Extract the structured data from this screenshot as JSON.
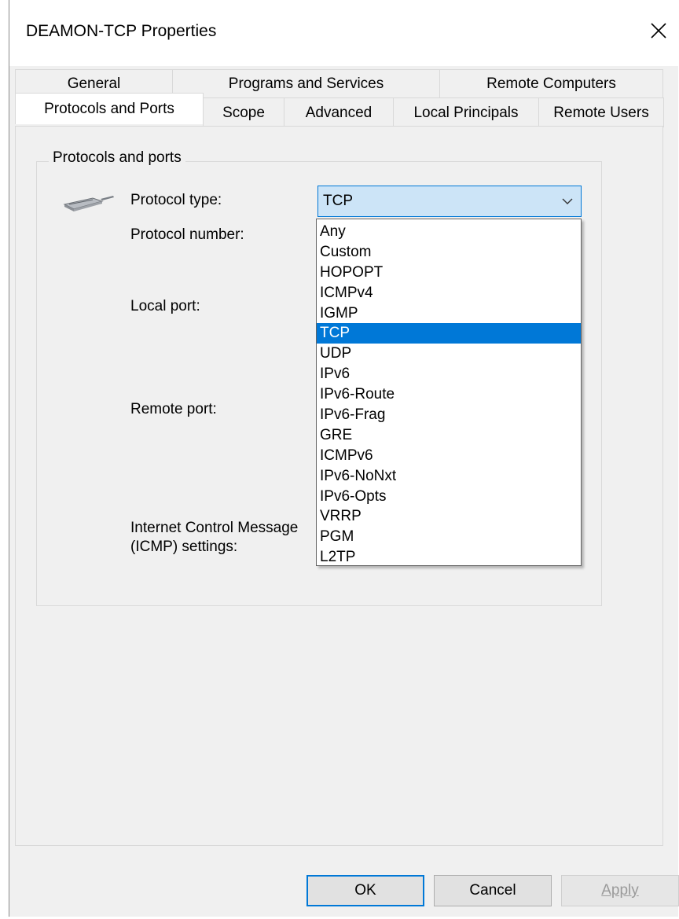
{
  "window": {
    "title": "DEAMON-TCP Properties"
  },
  "tabs": {
    "row1": [
      "General",
      "Programs and Services",
      "Remote Computers"
    ],
    "row2": [
      "Protocols and Ports",
      "Scope",
      "Advanced",
      "Local Principals",
      "Remote Users"
    ],
    "selected": "Protocols and Ports"
  },
  "group": {
    "legend": "Protocols and ports",
    "labels": {
      "protocol_type": "Protocol type:",
      "protocol_number": "Protocol number:",
      "local_port": "Local port:",
      "remote_port": "Remote port:",
      "icmp_line1": "Internet Control Message",
      "icmp_line2": "(ICMP) settings:"
    }
  },
  "protocol_combo": {
    "value": "TCP",
    "options": [
      "Any",
      "Custom",
      "HOPOPT",
      "ICMPv4",
      "IGMP",
      "TCP",
      "UDP",
      "IPv6",
      "IPv6-Route",
      "IPv6-Frag",
      "GRE",
      "ICMPv6",
      "IPv6-NoNxt",
      "IPv6-Opts",
      "VRRP",
      "PGM",
      "L2TP"
    ],
    "selected_index": 5
  },
  "buttons": {
    "ok": "OK",
    "cancel": "Cancel",
    "apply": "Apply"
  },
  "colors": {
    "accent": "#0078d7",
    "combo_bg": "#cce4f7",
    "window_bg": "#f0f0f0"
  }
}
